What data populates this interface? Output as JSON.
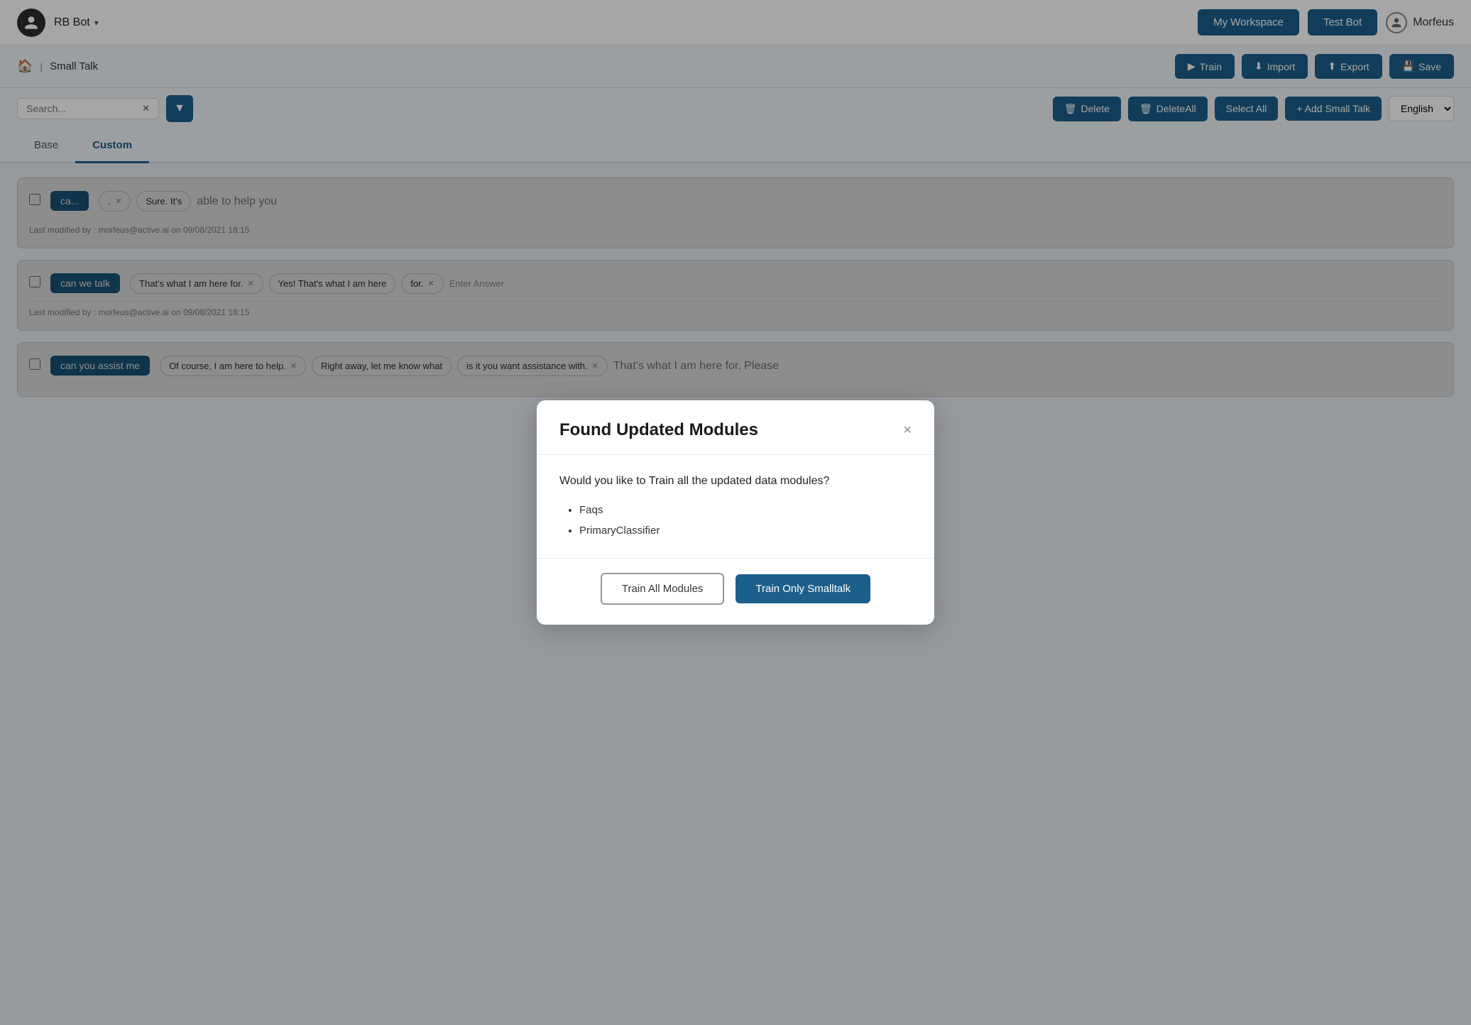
{
  "header": {
    "bot_name": "RB Bot",
    "my_workspace_label": "My Workspace",
    "test_bot_label": "Test Bot",
    "user_name": "Morfeus",
    "chevron": "▾"
  },
  "toolbar": {
    "home_icon": "🏠",
    "breadcrumb_label": "Small Talk",
    "train_label": "Train",
    "import_label": "Import",
    "export_label": "Export",
    "save_label": "Save"
  },
  "action_bar": {
    "search_placeholder": "Search...",
    "delete_label": "Delete",
    "delete_all_label": "DeleteAll",
    "select_all_label": "Select All",
    "add_small_talk_label": "+ Add Small Talk",
    "language": "English"
  },
  "tabs": [
    {
      "id": "base",
      "label": "Base"
    },
    {
      "id": "custom",
      "label": "Custom",
      "active": true
    }
  ],
  "small_talk_items": [
    {
      "id": "item1",
      "tag": "ca...",
      "responses": [
        {
          "text": ".",
          "has_x": true
        },
        {
          "text": "Sure. It's",
          "has_x": false
        }
      ],
      "extra_text": "able to help you",
      "modified_by": "morfeus@active.ai",
      "modified_date": "09/08/2021 18:15"
    },
    {
      "id": "item2",
      "tag": "can we talk",
      "responses": [
        {
          "text": "That's what I am here for.",
          "has_x": true
        },
        {
          "text": "Yes! That's what I am here",
          "has_x": false
        }
      ],
      "extra_chips": [
        {
          "text": "for.",
          "has_x": true
        }
      ],
      "enter_answer": "Enter Answer",
      "modified_by": "morfeus@active.ai",
      "modified_date": "09/08/2021 18:15"
    },
    {
      "id": "item3",
      "tag": "can you assist me",
      "responses": [
        {
          "text": "Of course, I am here to help.",
          "has_x": true
        },
        {
          "text": "Right away, let me know what",
          "has_x": false
        }
      ],
      "extra_chips": [
        {
          "text": "is it you want assistance with.",
          "has_x": true
        }
      ],
      "extra_text2": "That's what I am here for. Please",
      "modified_by": "",
      "modified_date": ""
    }
  ],
  "modal": {
    "title": "Found Updated Modules",
    "question": "Would you like to Train all the updated data modules?",
    "modules": [
      "Faqs",
      "PrimaryClassifier"
    ],
    "train_all_label": "Train All Modules",
    "train_smalltalk_label": "Train Only Smalltalk",
    "close_symbol": "×"
  }
}
